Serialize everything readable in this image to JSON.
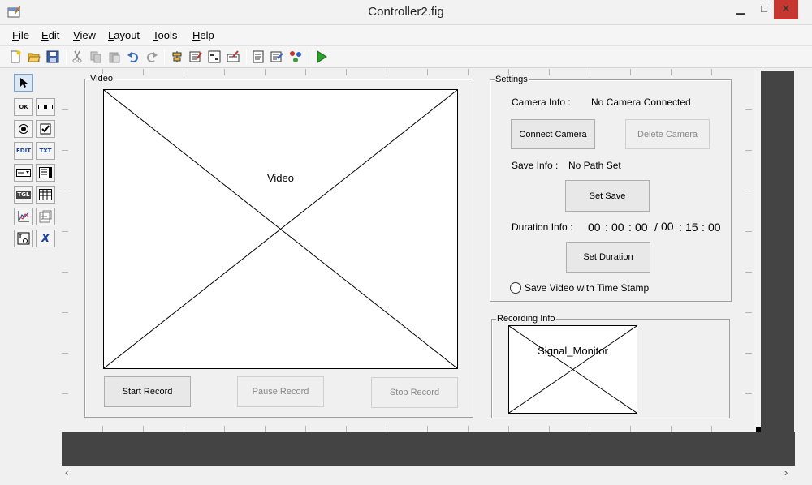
{
  "window": {
    "title": "Controller2.fig",
    "minimize": "▁",
    "maximize": "□",
    "close": "✕"
  },
  "menu": [
    {
      "key": "F",
      "rest": "ile"
    },
    {
      "key": "E",
      "rest": "dit"
    },
    {
      "key": "V",
      "rest": "iew"
    },
    {
      "key": "L",
      "rest": "ayout"
    },
    {
      "key": "T",
      "rest": "ools"
    },
    {
      "key": "H",
      "rest": "elp"
    }
  ],
  "toolbar_icons": [
    "new-icon",
    "open-icon",
    "save-icon",
    "cut-icon",
    "copy-icon",
    "paste-icon",
    "undo-icon",
    "redo-icon",
    "align-icon",
    "menu-editor-icon",
    "tab-order-icon",
    "toolbar-editor-icon",
    "mfile-editor-icon",
    "property-inspector-icon",
    "object-browser-icon",
    "run-icon"
  ],
  "palette": {
    "select": "select-tool-icon",
    "tools": [
      {
        "name": "push-button",
        "label": "OK"
      },
      {
        "name": "slider",
        "label": ""
      },
      {
        "name": "radio-button",
        "label": ""
      },
      {
        "name": "checkbox",
        "label": ""
      },
      {
        "name": "edit-text",
        "label": "EDIT"
      },
      {
        "name": "static-text",
        "label": "TXT"
      },
      {
        "name": "popup-menu",
        "label": ""
      },
      {
        "name": "listbox",
        "label": ""
      },
      {
        "name": "toggle-button",
        "label": "TGL"
      },
      {
        "name": "table",
        "label": ""
      },
      {
        "name": "axes",
        "label": ""
      },
      {
        "name": "panel",
        "label": ""
      },
      {
        "name": "button-group",
        "label": ""
      },
      {
        "name": "activex-control",
        "label": "X"
      }
    ]
  },
  "video_panel": {
    "title": "Video",
    "axes_label": "Video",
    "start_record": "Start Record",
    "pause_record": "Pause Record",
    "stop_record": "Stop Record"
  },
  "settings_panel": {
    "title": "Settings",
    "camera_info_label": "Camera Info :",
    "camera_info_value": "No Camera Connected",
    "connect_camera": "Connect Camera",
    "delete_camera": "Delete Camera",
    "save_info_label": "Save Info :",
    "save_info_value": "No Path Set",
    "set_save": "Set Save",
    "duration_info_label": "Duration Info :",
    "elapsed": {
      "h": "00",
      "m": "00",
      "s": "00"
    },
    "slash": "/",
    "total": {
      "h": "00",
      "m": "15",
      "s": "00"
    },
    "colon": ":",
    "set_duration": "Set Duration",
    "timestamp_label": "Save Video with Time Stamp"
  },
  "recording_panel": {
    "title": "Recording Info",
    "axes_label": "Signal_Monitor"
  },
  "scroll": {
    "left": "‹",
    "right": "›"
  }
}
